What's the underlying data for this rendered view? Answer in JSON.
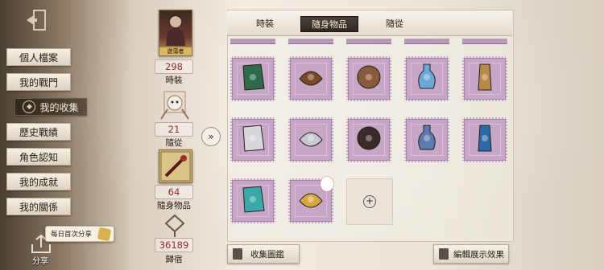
{
  "menu": {
    "items": [
      {
        "label": "個人檔案"
      },
      {
        "label": "我的戰門"
      },
      {
        "label": "我的收集",
        "active": true
      },
      {
        "label": "歷史戰績"
      },
      {
        "label": "角色認知"
      },
      {
        "label": "我的成就"
      },
      {
        "label": "我的關係"
      }
    ]
  },
  "share": {
    "label": "分享",
    "tip": "每日首次分享"
  },
  "stats": [
    {
      "value": "298",
      "label": "時裝",
      "card_caption": "遊蕩者"
    },
    {
      "value": "21",
      "label": "隨從"
    },
    {
      "value": "64",
      "label": "隨身物品"
    },
    {
      "value": "36189",
      "label": "歸宿"
    }
  ],
  "expand_icon": "double-chevron-right-icon",
  "tabs": [
    {
      "label": "時裝"
    },
    {
      "label": "隨身物品",
      "active": true
    },
    {
      "label": "隨從"
    }
  ],
  "items": [
    {
      "name": "green-book",
      "color": "#2f6a4a"
    },
    {
      "name": "teapot-compass",
      "color": "#7a4a28"
    },
    {
      "name": "spiral-shell",
      "color": "#8a5a3a"
    },
    {
      "name": "blue-potion",
      "color": "#6aa8d8"
    },
    {
      "name": "lantern-pendant",
      "color": "#b88a4a"
    },
    {
      "name": "silver-horn",
      "color": "#d8d8dc"
    },
    {
      "name": "chain-pendant",
      "color": "#c8c8d0"
    },
    {
      "name": "card-box",
      "color": "#3a2a2a"
    },
    {
      "name": "clef-orb",
      "color": "#5a7ab0"
    },
    {
      "name": "starry-lantern",
      "color": "#2e6aa8"
    },
    {
      "name": "teal-tassel",
      "color": "#3aa8a8"
    },
    {
      "name": "striped-pouch",
      "color": "#d8a840"
    }
  ],
  "buttons": {
    "collection": "收集圖鑑",
    "edit_display": "編輯展示效果"
  }
}
